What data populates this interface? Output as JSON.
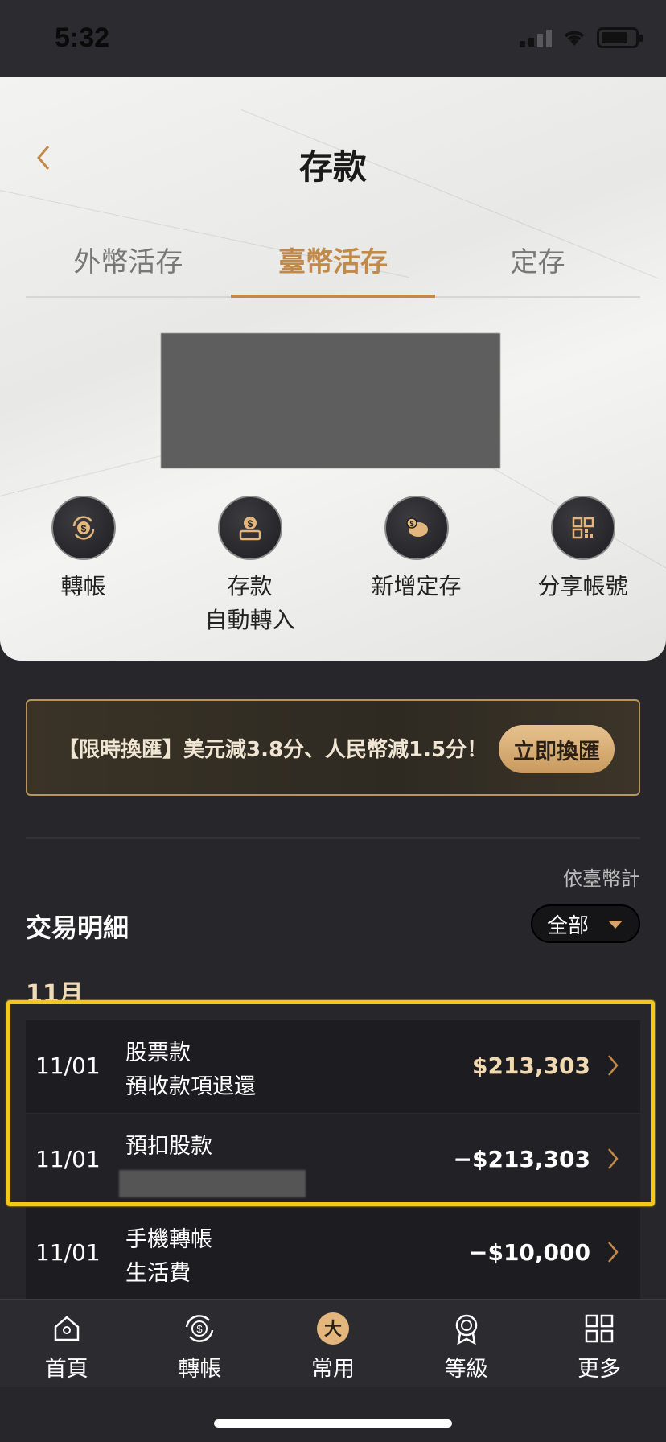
{
  "status": {
    "time": "5:32"
  },
  "header": {
    "title": "存款"
  },
  "tabs": [
    {
      "label": "外幣活存"
    },
    {
      "label": "臺幣活存"
    },
    {
      "label": "定存"
    }
  ],
  "actions": [
    {
      "label": "轉帳",
      "icon": "transfer-icon"
    },
    {
      "label": "存款\n自動轉入",
      "label_line1": "存款",
      "label_line2": "自動轉入",
      "icon": "deposit-icon"
    },
    {
      "label": "新增定存",
      "icon": "piggy-bank-icon"
    },
    {
      "label": "分享帳號",
      "icon": "qr-code-icon"
    }
  ],
  "promo": {
    "text": "【限時換匯】美元減3.8分、人民幣減1.5分！",
    "button": "立即換匯"
  },
  "transactions": {
    "currency_note": "依臺幣計",
    "title": "交易明細",
    "filter": "全部",
    "month": "11月",
    "rows": [
      {
        "date": "11/01",
        "desc_line1": "股票款",
        "desc_line2": "預收款項退還",
        "amount": "$213,303",
        "sign": "pos"
      },
      {
        "date": "11/01",
        "desc_line1": "預扣股款",
        "desc_line2": "",
        "amount": "−$213,303",
        "sign": "neg"
      },
      {
        "date": "11/01",
        "desc_line1": "手機轉帳",
        "desc_line2": "生活費",
        "amount": "−$10,000",
        "sign": "neg"
      }
    ]
  },
  "tabbar": [
    {
      "label": "首頁",
      "icon": "home-icon"
    },
    {
      "label": "轉帳",
      "icon": "transfer-icon"
    },
    {
      "label": "常用",
      "icon": "favorite-logo-icon"
    },
    {
      "label": "等級",
      "icon": "medal-icon"
    },
    {
      "label": "更多",
      "icon": "grid-icon"
    }
  ],
  "colors": {
    "accent": "#c28a4a",
    "highlight": "#f2c81b"
  }
}
